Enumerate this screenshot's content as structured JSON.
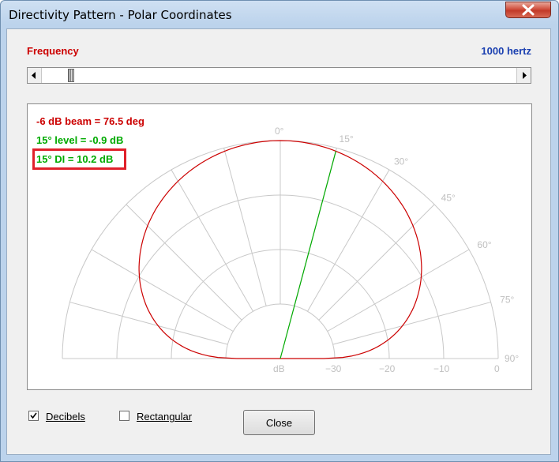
{
  "window": {
    "title": "Directivity Pattern - Polar Coordinates"
  },
  "frequency": {
    "label": "Frequency",
    "value": "1000 hertz"
  },
  "info": {
    "beam": "-6 dB beam = 76.5 deg",
    "level": "15° level = -0.9 dB",
    "di": "15° DI = 10.2 dB"
  },
  "polar": {
    "angle_labels": [
      "0°",
      "15°",
      "30°",
      "45°",
      "60°",
      "75°",
      "90°"
    ],
    "radial_labels": [
      "dB",
      "−30",
      "−20",
      "−10",
      "0"
    ],
    "highlight_angle_deg": 15
  },
  "options": {
    "decibels": "Decibels",
    "decibels_checked": true,
    "rectangular": "Rectangular",
    "rectangular_checked": false
  },
  "buttons": {
    "close": "Close"
  },
  "colors": {
    "pattern": "#cc0000",
    "marker": "#00aa00",
    "grid": "#c8c8c8",
    "highlight_box": "#e0202a"
  }
}
